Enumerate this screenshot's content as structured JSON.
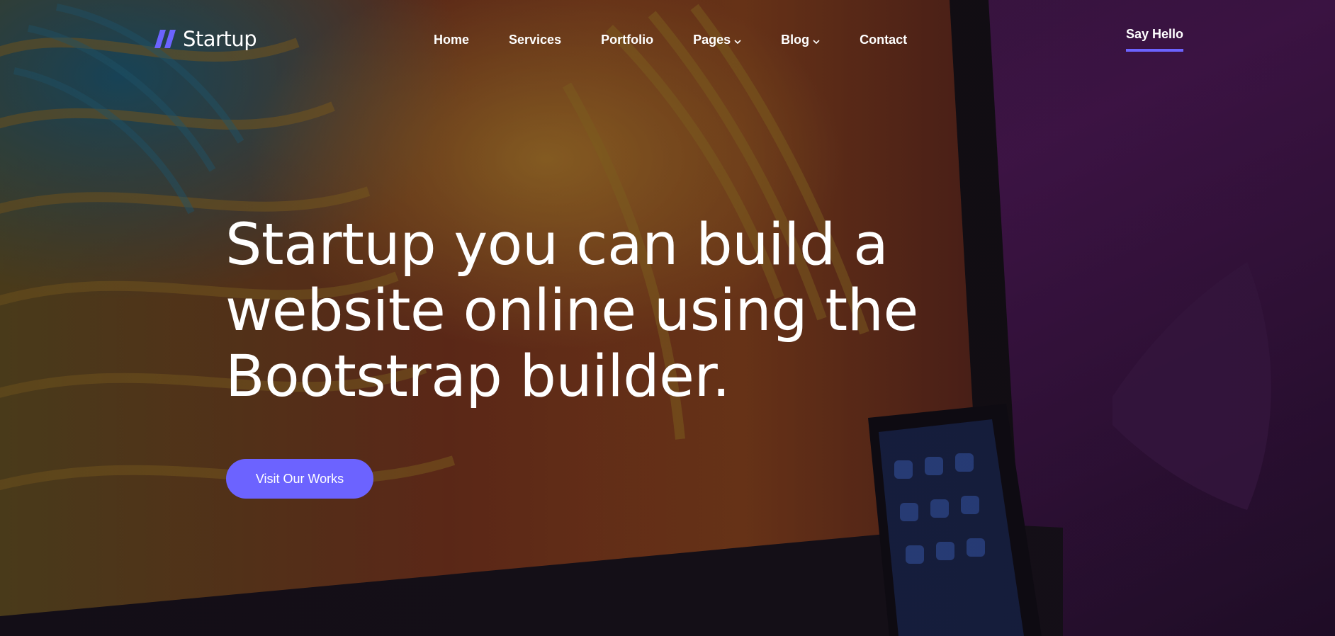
{
  "brand": {
    "name": "Startup",
    "accent_color": "#6c63ff",
    "logo_icon": "double-slash-logo-icon"
  },
  "nav": {
    "items": [
      {
        "label": "Home",
        "has_dropdown": false
      },
      {
        "label": "Services",
        "has_dropdown": false
      },
      {
        "label": "Portfolio",
        "has_dropdown": false
      },
      {
        "label": "Pages",
        "has_dropdown": true,
        "icon": "chevron-down-icon"
      },
      {
        "label": "Blog",
        "has_dropdown": true,
        "icon": "chevron-down-icon"
      },
      {
        "label": "Contact",
        "has_dropdown": false
      }
    ]
  },
  "header_cta": {
    "label": "Say Hello"
  },
  "hero": {
    "headline_lines": [
      "Startup you can build a",
      "website online using the",
      "Bootstrap builder."
    ],
    "button_label": "Visit Our Works"
  }
}
